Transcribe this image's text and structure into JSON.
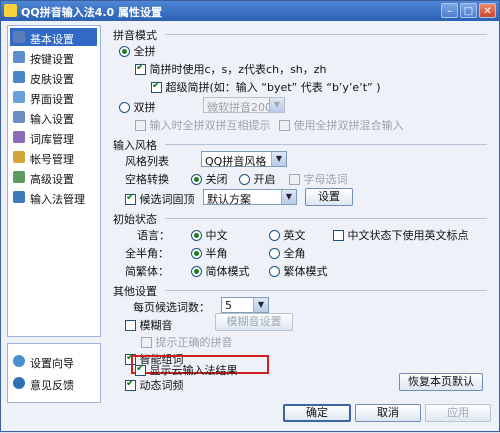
{
  "window": {
    "title": "QQ拼音输入法4.0 属性设置"
  },
  "sidebar": {
    "items": [
      {
        "label": "基本设置",
        "active": true,
        "icon": "wrench-icon",
        "color": "#5a7fb8"
      },
      {
        "label": "按键设置",
        "icon": "keyboard-icon",
        "color": "#5d8fcf"
      },
      {
        "label": "皮肤设置",
        "icon": "shirt-icon",
        "color": "#4a86c8"
      },
      {
        "label": "界面设置",
        "icon": "window-icon",
        "color": "#6aa0d8"
      },
      {
        "label": "输入设置",
        "icon": "input-icon",
        "color": "#6b8fc0"
      },
      {
        "label": "词库管理",
        "icon": "book-icon",
        "color": "#8b6db8"
      },
      {
        "label": "帐号管理",
        "icon": "account-icon",
        "color": "#d4a63a"
      },
      {
        "label": "高级设置",
        "icon": "advanced-icon",
        "color": "#5f9a5f"
      },
      {
        "label": "输入法管理",
        "icon": "manage-icon",
        "color": "#3f7ab8"
      }
    ],
    "bottom": [
      {
        "label": "设置向导",
        "icon": "wizard-icon"
      },
      {
        "label": "意见反馈",
        "icon": "feedback-icon"
      }
    ]
  },
  "pinyin_mode": {
    "section_title": "拼音模式",
    "full": "全拼",
    "simplified": "简拼时使用c，s，z代表ch，sh，zh",
    "super": "超级简拼(如：输入 “byet” 代表 “b’y’e’t” )",
    "double": "双拼",
    "double_scheme": "微软拼音2003",
    "double_hint": "输入时全拼双拼互相提示",
    "double_mix": "使用全拼双拼混合输入"
  },
  "input_style": {
    "section_title": "输入风格",
    "style_list_label": "风格列表",
    "style_value": "QQ拼音风格",
    "space_label": "空格转换",
    "space_off": "关闭",
    "space_on": "开启",
    "letter_select": "字母选词",
    "candidate_label": "候选词固顶",
    "candidate_value": "默认方案",
    "settings_btn": "设置"
  },
  "initial_state": {
    "section_title": "初始状态",
    "lang_label": "语言：",
    "lang_cn": "中文",
    "lang_en": "英文",
    "cn_en_punct": "中文状态下使用英文标点",
    "width_label": "全半角：",
    "half": "半角",
    "full": "全角",
    "script_label": "简繁体：",
    "simplified": "简体模式",
    "traditional": "繁体模式"
  },
  "other": {
    "section_title": "其他设置",
    "per_page_label": "每页候选词数：",
    "per_page_value": "5",
    "fuzzy": "模糊音",
    "fuzzy_btn": "模糊音设置",
    "correct_hint": "提示正确的拼音",
    "smart": "智能组词",
    "cloud": "显示云输入法结果",
    "dynamic": "动态词频",
    "restore_btn": "恢复本页默认"
  },
  "footer": {
    "ok": "确定",
    "cancel": "取消",
    "apply": "应用"
  },
  "colors": {
    "accent": "#3169c6",
    "highlight": "#d12222",
    "titlebar": "#2c5fb0"
  }
}
